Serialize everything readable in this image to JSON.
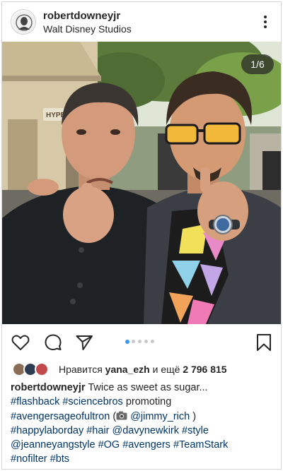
{
  "post": {
    "username": "robertdowneyjr",
    "location": "Walt Disney Studios",
    "image_counter": "1/6",
    "carousel_dots": 5,
    "carousel_active": 0
  },
  "likes": {
    "prefix": "Нравится",
    "user": "yana_ezh",
    "middle": "и ещё",
    "count": "2 796 815"
  },
  "caption": {
    "username": "robertdowneyjr",
    "text": "Twice as sweet as sugar...",
    "l2_tag1": "#flashback",
    "l2_tag2": "#sciencebros",
    "l2_word": "promoting",
    "l3_tag": "#avengersageofultron",
    "l3_open": "(",
    "l3_mention": "@jimmy_rich",
    "l3_close": ")",
    "l4_t1": "#happylaborday",
    "l4_t2": "#hair",
    "l4_t3": "@davynewkirk",
    "l4_t4": "#style",
    "l5_t1": "@jeanneyangstyle",
    "l5_t2": "#OG",
    "l5_t3": "#avengers",
    "l5_t4": "#TeamStark",
    "l6_t1": "#nofilter",
    "l6_t2": "#bts"
  },
  "icons": {
    "more": "more-vertical-icon",
    "like": "heart-icon",
    "comment": "comment-icon",
    "share": "paper-plane-icon",
    "save": "bookmark-icon",
    "emoji": "camera-emoji-icon"
  },
  "colors": {
    "link": "#003569",
    "active_dot": "#3897f0",
    "inactive_dot": "#c8c8c8"
  }
}
